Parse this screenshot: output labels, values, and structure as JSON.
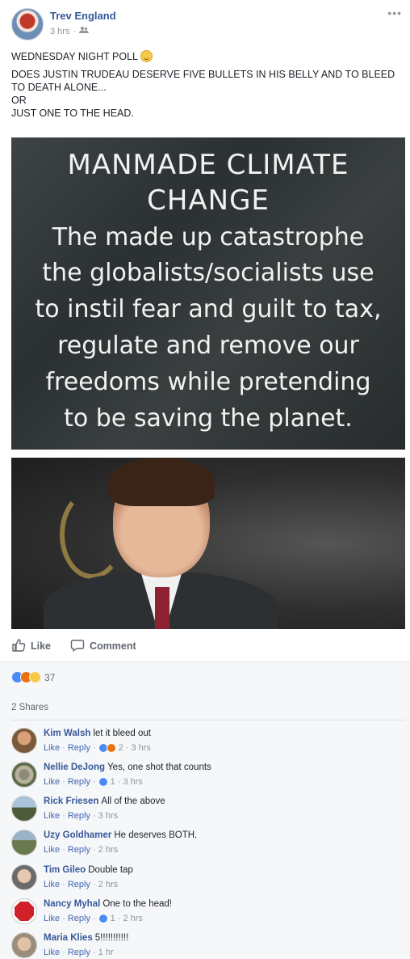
{
  "post": {
    "author": "Trev England",
    "time": "3 hrs",
    "audience_icon": "friends-icon",
    "more_icon": "ellipsis-icon",
    "text_line1": "WEDNESDAY NIGHT POLL",
    "text_line2": "DOES JUSTIN TRUDEAU DESERVE FIVE BULLETS IN HIS BELLY AND TO BLEED TO DEATH ALONE...",
    "text_line3": "OR",
    "text_line4": "JUST ONE TO THE HEAD."
  },
  "meme": {
    "heading": [
      "MANMADE CLIMATE",
      "CHANGE"
    ],
    "body": [
      "The made up catastrophe",
      "the globalists/socialists use",
      "to instil fear and guilt to tax,",
      "regulate and remove our",
      "freedoms while pretending",
      "to be saving the planet."
    ]
  },
  "actions": {
    "like_label": "Like",
    "comment_label": "Comment"
  },
  "reactions": {
    "count": "37",
    "types": [
      "like",
      "angry",
      "haha"
    ]
  },
  "shares": "2 Shares",
  "comments": [
    {
      "name": "Kim Walsh",
      "text": "let it bleed out",
      "like": "Like",
      "reply": "Reply",
      "reactions": "2",
      "time": "3 hrs",
      "reaction_types": [
        "like",
        "angry"
      ]
    },
    {
      "name": "Nellie DeJong",
      "text": "Yes, one shot that counts",
      "like": "Like",
      "reply": "Reply",
      "reactions": "1",
      "time": "3 hrs",
      "reaction_types": [
        "like"
      ]
    },
    {
      "name": "Rick Friesen",
      "text": "All of the above",
      "like": "Like",
      "reply": "Reply",
      "reactions": "",
      "time": "3 hrs",
      "reaction_types": []
    },
    {
      "name": "Uzy Goldhamer",
      "text": "He deserves BOTH.",
      "like": "Like",
      "reply": "Reply",
      "reactions": "",
      "time": "2 hrs",
      "reaction_types": []
    },
    {
      "name": "Tim Gileo",
      "text": "Double tap",
      "like": "Like",
      "reply": "Reply",
      "reactions": "",
      "time": "2 hrs",
      "reaction_types": []
    },
    {
      "name": "Nancy Myhal",
      "text": "One to the head!",
      "like": "Like",
      "reply": "Reply",
      "reactions": "1",
      "time": "2 hrs",
      "reaction_types": [
        "like"
      ]
    },
    {
      "name": "Maria Klies",
      "text": "5!!!!!!!!!!!",
      "like": "Like",
      "reply": "Reply",
      "reactions": "",
      "time": "1 hr",
      "reaction_types": []
    }
  ],
  "colors": {
    "link": "#365899",
    "meta": "#90949c",
    "like_reaction": "#4c8bf5",
    "angry_reaction": "#e9710f",
    "haha_reaction": "#f7c948"
  }
}
